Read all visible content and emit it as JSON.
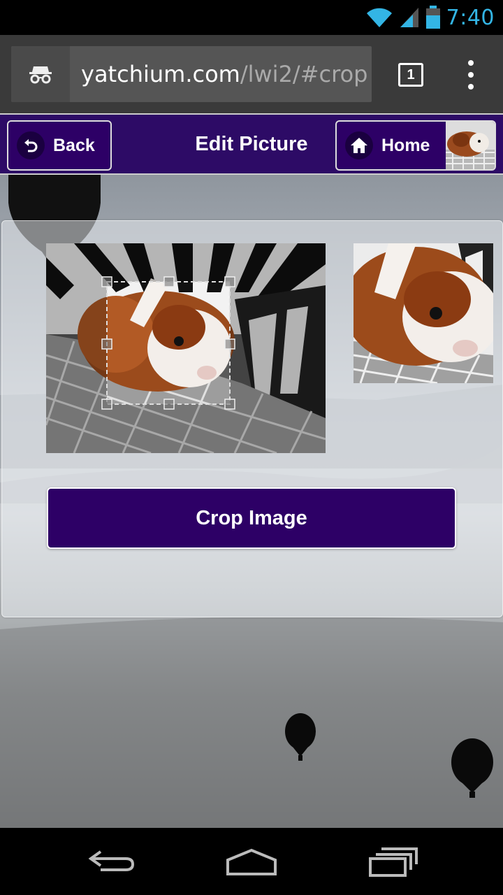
{
  "status_bar": {
    "time": "7:40",
    "icons": [
      "wifi-icon",
      "signal-icon",
      "battery-icon"
    ]
  },
  "browser": {
    "url_host": "yatchium.com",
    "url_path": "/lwi2/#crop",
    "tab_count": "1",
    "icons": [
      "incognito-icon",
      "tabs-icon",
      "overflow-menu-icon"
    ]
  },
  "header": {
    "back_label": "Back",
    "title": "Edit Picture",
    "home_label": "Home"
  },
  "editor": {
    "crop_button_label": "Crop Image"
  },
  "colors": {
    "brand_purple": "#2d0066",
    "clock_blue": "#33b5e5"
  },
  "navbar": {
    "icons": [
      "back-nav-icon",
      "home-nav-icon",
      "recents-nav-icon"
    ]
  }
}
